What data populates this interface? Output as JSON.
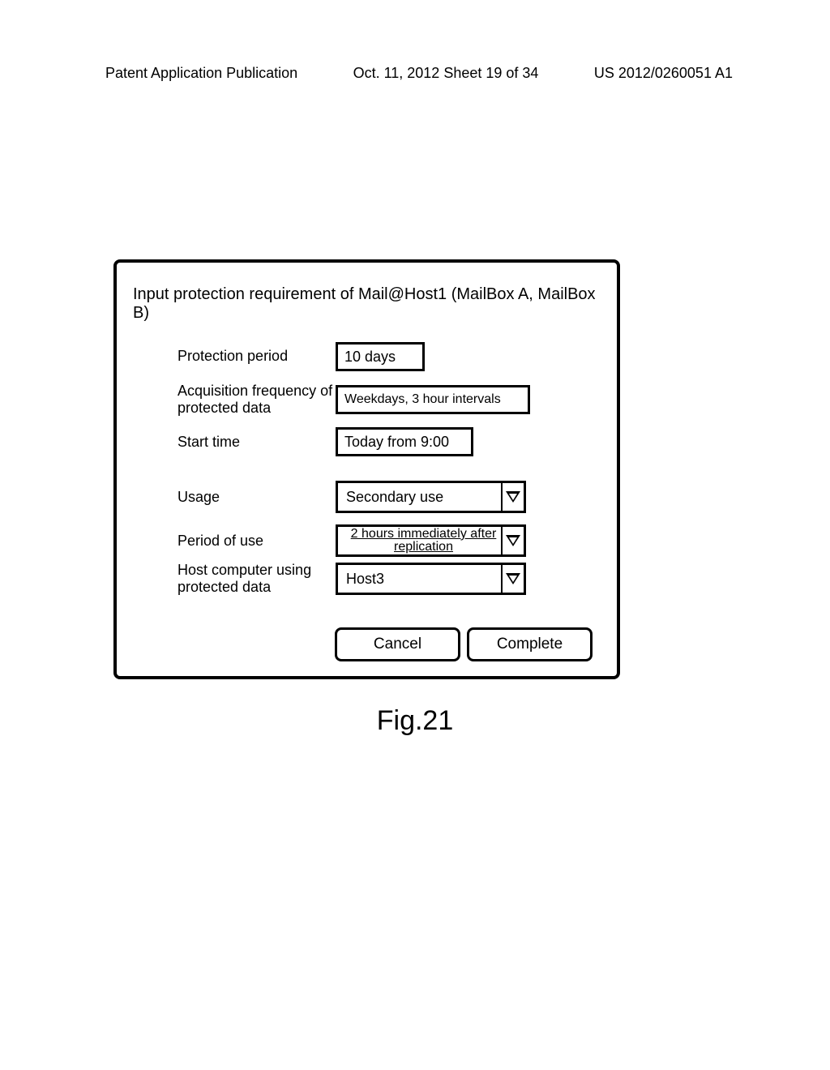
{
  "header": {
    "left": "Patent Application Publication",
    "center": "Oct. 11, 2012  Sheet 19 of 34",
    "right": "US 2012/0260051 A1"
  },
  "dialog": {
    "title": "Input protection requirement of Mail@Host1 (MailBox A, MailBox B)",
    "fields": {
      "protection_period": {
        "label": "Protection period",
        "value": "10 days"
      },
      "acquisition_frequency": {
        "label": "Acquisition frequency of protected data",
        "value": "Weekdays, 3 hour intervals"
      },
      "start_time": {
        "label": "Start time",
        "value": "Today from 9:00"
      },
      "usage": {
        "label": "Usage",
        "value": "Secondary use"
      },
      "period_of_use": {
        "label": "Period of use",
        "value": "2 hours immediately after replication"
      },
      "host_using": {
        "label": "Host computer using protected data",
        "value": "Host3"
      }
    },
    "buttons": {
      "cancel": "Cancel",
      "complete": "Complete"
    }
  },
  "figure_caption": "Fig.21"
}
